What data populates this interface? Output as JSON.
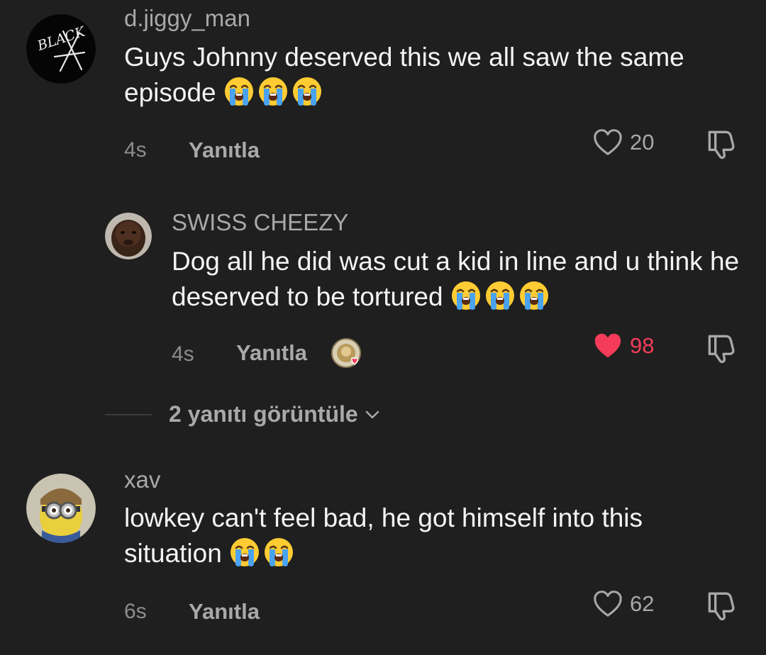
{
  "comments": [
    {
      "username": "d.jiggy_man",
      "text": "Guys Johnny deserved this we all saw the same episode",
      "emoji_count": 3,
      "time": "4s",
      "reply_label": "Yanıtla",
      "likes": "20",
      "liked": false
    },
    {
      "username": "SWISS CHEEZY",
      "text": "Dog all he did was cut a kid in line and u think he deserved to be tortured",
      "emoji_count": 3,
      "time": "4s",
      "reply_label": "Yanıtla",
      "likes": "98",
      "liked": true
    },
    {
      "username": "xav",
      "text": "lowkey can't feel bad, he got himself into this situation",
      "emoji_count": 2,
      "time": "6s",
      "reply_label": "Yanıtla",
      "likes": "62",
      "liked": false
    }
  ],
  "view_replies": {
    "label": "2 yanıtı görüntüle"
  },
  "avatar1_logo_text": "BLACK",
  "colors": {
    "background": "#1f1f1f",
    "liked": "#f43c5a",
    "muted": "#a8a8a8"
  },
  "icons": {
    "like": "heart-outline-icon",
    "liked": "heart-filled-icon",
    "dislike": "thumbs-down-icon",
    "emoji": "loudly-crying-face-emoji",
    "chevron": "chevron-down-icon"
  }
}
